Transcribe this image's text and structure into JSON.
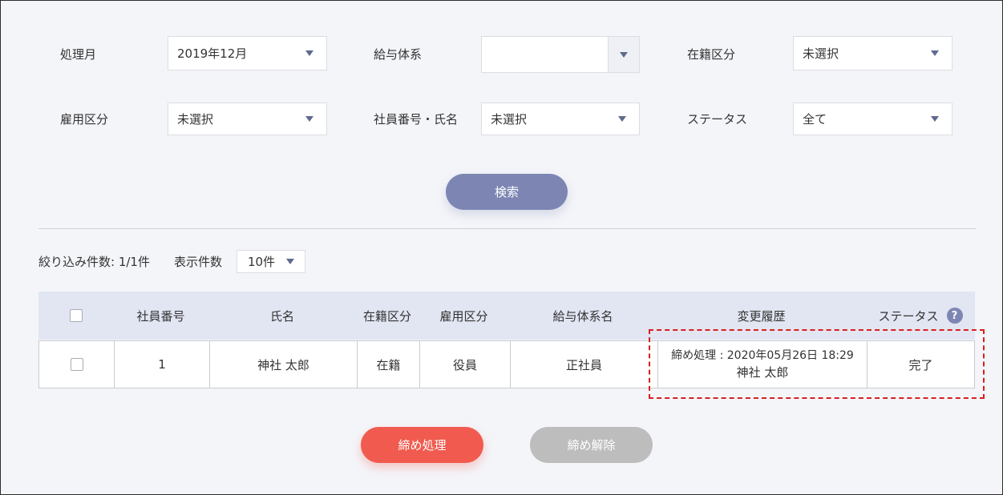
{
  "filters": {
    "processing_month": {
      "label": "処理月",
      "value": "2019年12月"
    },
    "pay_system": {
      "label": "給与体系",
      "value": ""
    },
    "enrollment": {
      "label": "在籍区分",
      "value": "未選択"
    },
    "employment": {
      "label": "雇用区分",
      "value": "未選択"
    },
    "employee": {
      "label": "社員番号・氏名",
      "value": "未選択"
    },
    "status": {
      "label": "ステータス",
      "value": "全て"
    }
  },
  "search_button": "検索",
  "results": {
    "count_text": "絞り込み件数: 1/1件",
    "per_page_label": "表示件数",
    "per_page_value": "10件"
  },
  "table": {
    "headers": {
      "employee_no": "社員番号",
      "name": "氏名",
      "enrollment": "在籍区分",
      "employment": "雇用区分",
      "pay_system": "給与体系名",
      "history": "変更履歴",
      "status": "ステータス",
      "help": "?"
    },
    "rows": [
      {
        "employee_no": "1",
        "name": "神社 太郎",
        "enrollment": "在籍",
        "employment": "役員",
        "pay_system": "正社員",
        "history_line1": "締め処理 : 2020年05月26日 18:29",
        "history_line2": "神社 太郎",
        "status": "完了"
      }
    ]
  },
  "actions": {
    "close_label": "締め処理",
    "release_label": "締め解除"
  },
  "colors": {
    "accent": "#7d86b3",
    "danger": "#f15b4f",
    "disabled": "#bdbdbd",
    "table_header": "#e2e5f2",
    "highlight_border": "#d92020"
  }
}
